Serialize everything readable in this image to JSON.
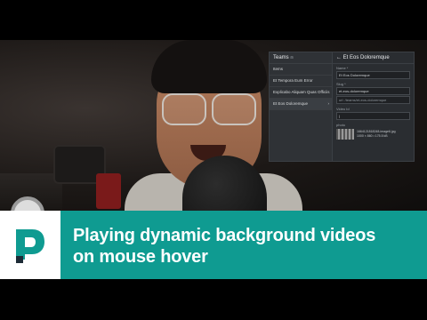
{
  "panel": {
    "header_left": "Teams",
    "header_right": "Et Eos Doloremque",
    "team_items": [
      {
        "label": "Items"
      },
      {
        "label": "Et Tempora Eum Error"
      },
      {
        "label": "Explicabo Aliquam Quas Officiis"
      },
      {
        "label": "Et Eos Doloremque"
      }
    ],
    "fields": {
      "name_label": "Name *",
      "name_value": "Et Eos Doloremque",
      "slug_label": "Slug *",
      "slug_value": "et-eos-doloremque",
      "url_value": "url: /teams/et-eos-doloremque",
      "video_label": "Video Id",
      "video_value": "|",
      "photo_label": "photo",
      "photo_filename": "1664121818248-image6.jpg",
      "photo_meta": "1000 × 860 • 175.5 kB"
    }
  },
  "banner": {
    "line1": "Playing dynamic background videos",
    "line2": "on mouse hover",
    "bg_color": "#0f9b91"
  }
}
